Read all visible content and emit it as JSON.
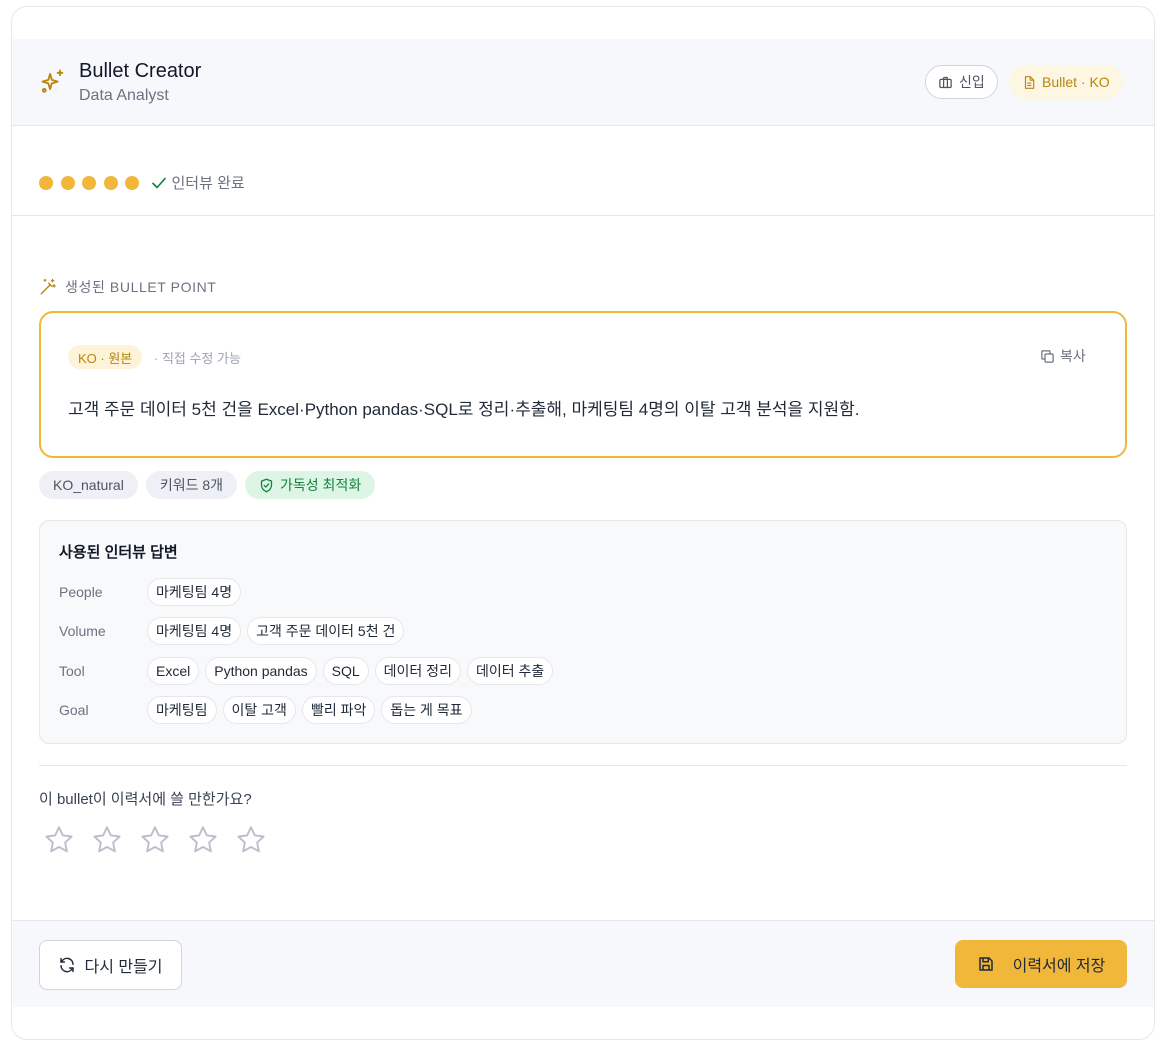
{
  "header": {
    "title": "Bullet Creator",
    "subtitle": "Data Analyst",
    "level_pill": "신입",
    "mode_pill": "Bullet · KO",
    "icon": "sparkles-icon"
  },
  "progress": {
    "steps_total": 5,
    "steps_completed": 5,
    "status_label": "인터뷰 완료"
  },
  "section": {
    "title": "생성된 BULLET POINT"
  },
  "bullet": {
    "lang_tag": "KO · 원본",
    "edit_hint": "· 직접 수정 가능",
    "copy_label": "복사",
    "text": "고객 주문 데이터 5천 건을 Excel·Python pandas·SQL로 정리·추출해, 마케팅팀 4명의 이탈 고객 분석을 지원함."
  },
  "chips": {
    "style": "KO_natural",
    "keywords": "키워드 8개",
    "readability": "가독성 최적화"
  },
  "answers": {
    "title": "사용된 인터뷰 답변",
    "rows": [
      {
        "label": "People",
        "tags": [
          "마케팅팀 4명"
        ]
      },
      {
        "label": "Volume",
        "tags": [
          "마케팅팀 4명",
          "고객 주문 데이터 5천 건"
        ]
      },
      {
        "label": "Tool",
        "tags": [
          "Excel",
          "Python pandas",
          "SQL",
          "데이터 정리",
          "데이터 추출"
        ]
      },
      {
        "label": "Goal",
        "tags": [
          "마케팅팀",
          "이탈 고객",
          "빨리 파악",
          "돕는 게 목표"
        ]
      }
    ]
  },
  "rating": {
    "question": "이 bullet이 이력서에 쓸 만한가요?",
    "stars_total": 5,
    "stars_selected": 0
  },
  "footer": {
    "retry_label": "다시 만들기",
    "save_label": "이력서에 저장"
  },
  "colors": {
    "accent": "#f0b73a",
    "accent_text": "#b8860b",
    "success": "#15803d"
  }
}
